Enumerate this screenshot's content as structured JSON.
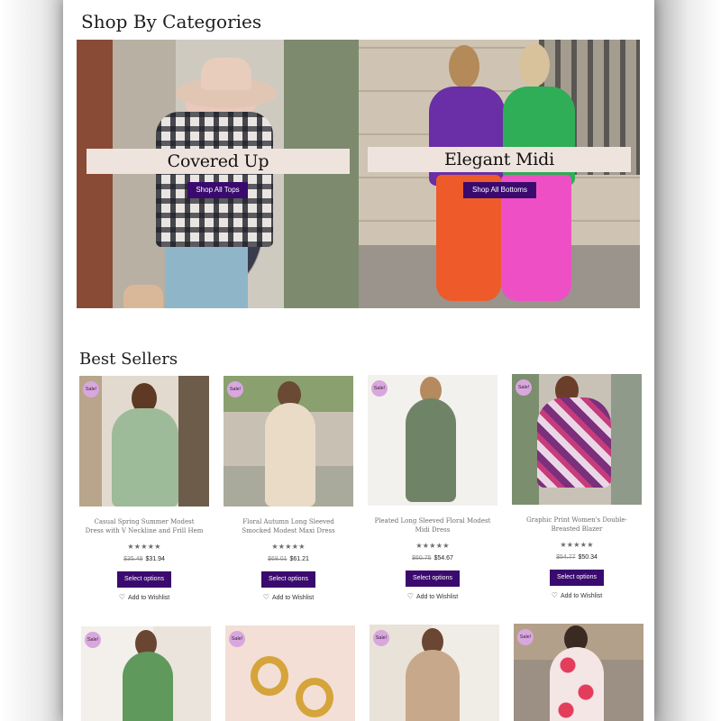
{
  "sections": {
    "categories_title": "Shop By Categories",
    "best_sellers_title": "Best Sellers"
  },
  "categories": [
    {
      "label": "Covered Up",
      "button": "Shop All Tops"
    },
    {
      "label": "Elegant Midi",
      "button": "Shop All Bottoms"
    }
  ],
  "common": {
    "sale_badge": "Sale!",
    "select_options": "Select options",
    "add_to_wishlist": "Add to Wishlist",
    "stars": "★★★★★"
  },
  "products": [
    {
      "title": "Casual Spring Summer Modest Dress with V Neckline and Frill Hem",
      "old_price": "$35.49",
      "price": "$31.94"
    },
    {
      "title": "Floral Autumn Long Sleeved Smocked Modest Maxi Dress",
      "old_price": "$68.01",
      "price": "$61.21"
    },
    {
      "title": "Pleated Long Sleeved Floral Modest Midi Dress",
      "old_price": "$60.75",
      "price": "$54.67"
    },
    {
      "title": "Graphic Print Women's Double-Breasted Blazer",
      "old_price": "$54.77",
      "price": "$50.34"
    },
    {
      "title": "",
      "old_price": "",
      "price": ""
    },
    {
      "title": "",
      "old_price": "",
      "price": ""
    },
    {
      "title": "",
      "old_price": "",
      "price": ""
    },
    {
      "title": "",
      "old_price": "",
      "price": ""
    }
  ]
}
